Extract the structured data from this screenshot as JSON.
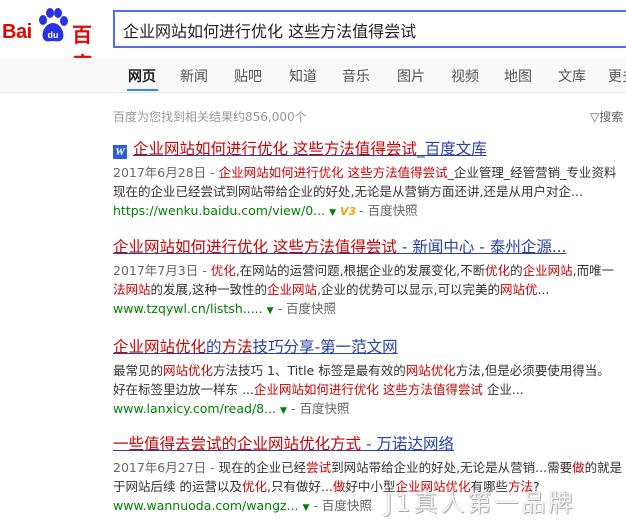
{
  "logo": {
    "part1": "Bai",
    "part2": "百度",
    "paw_text": "du"
  },
  "search": {
    "query": "企业网站如何进行优化 这些方法值得尝试"
  },
  "nav": {
    "items": [
      "网页",
      "新闻",
      "贴吧",
      "知道",
      "音乐",
      "图片",
      "视频",
      "地图",
      "文库",
      "更多"
    ],
    "active": "网页"
  },
  "stat": "百度为您找到相关结果约856,000个",
  "tool": "搜索",
  "results": [
    {
      "title": [
        {
          "t": "企业网站如何进行优化 这些方法值得尝试",
          "hl": true
        },
        {
          "t": "_百度文库",
          "hl": false
        }
      ],
      "line1": [
        {
          "t": "2017年6月28日 - ",
          "cls": "date"
        },
        {
          "t": "企业网站如何进行优化 这些方法值得尝试",
          "hl": true
        },
        {
          "t": "_企业管理_经管营销_专业资料"
        }
      ],
      "line2": [
        {
          "t": "现在的企业已经尝试到网站带给企业的好处,无论是从营销方面还讲,还是从用户对企..."
        }
      ],
      "url": "https://wenku.baidu.com/view/0...",
      "v3": "V3",
      "snap": "百度快照"
    },
    {
      "title": [
        {
          "t": "企业网站如何进行优化 这些方法值得尝试",
          "hl": true
        },
        {
          "t": " - 新闻中心 - 泰州企源...",
          "hl": false
        }
      ],
      "line1": [
        {
          "t": "2017年7月3日 - ",
          "cls": "date"
        },
        {
          "t": "优化",
          "hl": true
        },
        {
          "t": ",在网站的运营问题,根据企业的发展变化,不断"
        },
        {
          "t": "优化",
          "hl": true
        },
        {
          "t": "的"
        },
        {
          "t": "企业网站",
          "hl": true
        },
        {
          "t": ",而唯一"
        }
      ],
      "line2": [
        {
          "t": "法网站",
          "hl": true
        },
        {
          "t": "的发展,这种一致性的"
        },
        {
          "t": "企业网站",
          "hl": true
        },
        {
          "t": ",企业的优势可以显示,可以完美的"
        },
        {
          "t": "网站优",
          "hl": true
        },
        {
          "t": "..."
        }
      ],
      "url": "www.tzqywl.cn/listsh.....",
      "snap": "百度快照"
    },
    {
      "title": [
        {
          "t": "企业网站优化",
          "hl": true
        },
        {
          "t": "的",
          "hl": false
        },
        {
          "t": "方法",
          "hl": true
        },
        {
          "t": "技巧分享-第一范文网",
          "hl": false
        }
      ],
      "line1": [
        {
          "t": "最常见的"
        },
        {
          "t": "网站优化",
          "hl": true
        },
        {
          "t": "方法技巧 1、Title 标签是最有效的"
        },
        {
          "t": "网站优化",
          "hl": true
        },
        {
          "t": "方法,但是必须要使用得当。"
        }
      ],
      "line2": [
        {
          "t": "好在标签里边放一样东 ..."
        },
        {
          "t": "企业网站如何进行优化 这些方法值得尝试",
          "hl": true
        },
        {
          "t": " 企业..."
        }
      ],
      "url": "www.lanxicy.com/read/8...",
      "snap": "百度快照"
    },
    {
      "title": [
        {
          "t": "一些值得去尝试的企业网站优化方式",
          "hl": true
        },
        {
          "t": " - 万诺达网络",
          "hl": false
        }
      ],
      "line1": [
        {
          "t": "2017年6月27日 - ",
          "cls": "date"
        },
        {
          "t": "现在的企业已经"
        },
        {
          "t": "尝试",
          "hl": true
        },
        {
          "t": "到网站带给企业的好处,无论是从营销...需要"
        },
        {
          "t": "做",
          "hl": true
        },
        {
          "t": "的就是"
        }
      ],
      "line2": [
        {
          "t": "于网站后续 的运营以及"
        },
        {
          "t": "优化",
          "hl": true
        },
        {
          "t": ",只有做好..."
        },
        {
          "t": "做",
          "hl": true
        },
        {
          "t": "好中小型"
        },
        {
          "t": "企业网站优化",
          "hl": true
        },
        {
          "t": "有哪些"
        },
        {
          "t": "方法",
          "hl": true
        },
        {
          "t": "?"
        }
      ],
      "url": "www.wannuoda.com/wangz...",
      "snap": "百度快照"
    }
  ],
  "watermark": "J1真人第一品牌",
  "colors": {
    "brand_red": "#e10601",
    "link_blue": "#2440b3",
    "highlight_red": "#cc0000",
    "url_green": "#008000",
    "search_border": "#4e6ef2"
  }
}
